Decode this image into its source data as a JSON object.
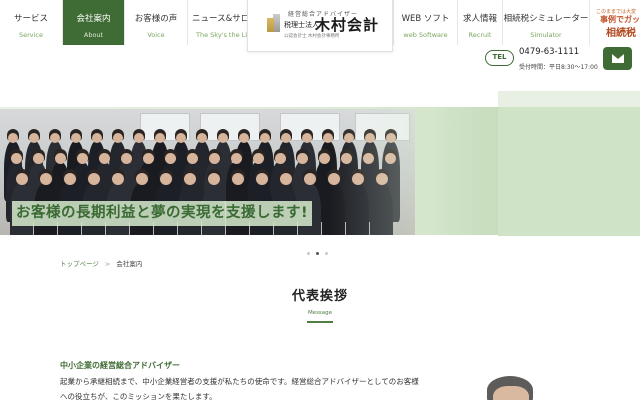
{
  "nav": {
    "items": [
      {
        "label": "サービス",
        "sub": "Service"
      },
      {
        "label": "会社案内",
        "sub": "About"
      },
      {
        "label": "お客様の声",
        "sub": "Voice"
      },
      {
        "label": "ニュース&サロン",
        "sub": "The Sky's the Limit"
      },
      {
        "label": "WEB ソフト",
        "sub": "web Software"
      },
      {
        "label": "求人情報",
        "sub": "Recruit"
      },
      {
        "label": "相続税シミュレーター",
        "sub": "Simulator"
      }
    ],
    "active_index": 1
  },
  "logo": {
    "tagline": "経営総合アドバイザー",
    "corp_type": "税理士法人",
    "name": "木村会計",
    "subline": "公認会計士 木村会計事務所"
  },
  "promo": {
    "small": "このままでは大変",
    "line1": "事例でガッテ",
    "line2": "相続税"
  },
  "contact": {
    "tel_label": "TEL",
    "tel_number": "0479-63-1111",
    "hours": "受付時間：平日8:30〜17:00",
    "mail_icon": "envelope-icon"
  },
  "hero": {
    "caption": "お客様の長期利益と夢の実現を支援します!",
    "slide_count": 3,
    "active_slide": 1
  },
  "breadcrumb": {
    "home": "トップページ",
    "separator": ">",
    "current": "会社案内"
  },
  "section": {
    "title": "代表挨拶",
    "subtitle": "Message"
  },
  "message": {
    "lead": "中小企業の経営総合アドバイザー",
    "body": "起業から承継相続まで、中小企業経営者の支援が私たちの使命です。経営総合アドバイザーとしてのお客様への役立ちが、このミッションを果たします。"
  },
  "colors": {
    "brand_green": "#3f6b34",
    "accent_green": "#4f7d45",
    "hero_bg": "#dcebd5",
    "promo_orange": "#c2542a"
  }
}
